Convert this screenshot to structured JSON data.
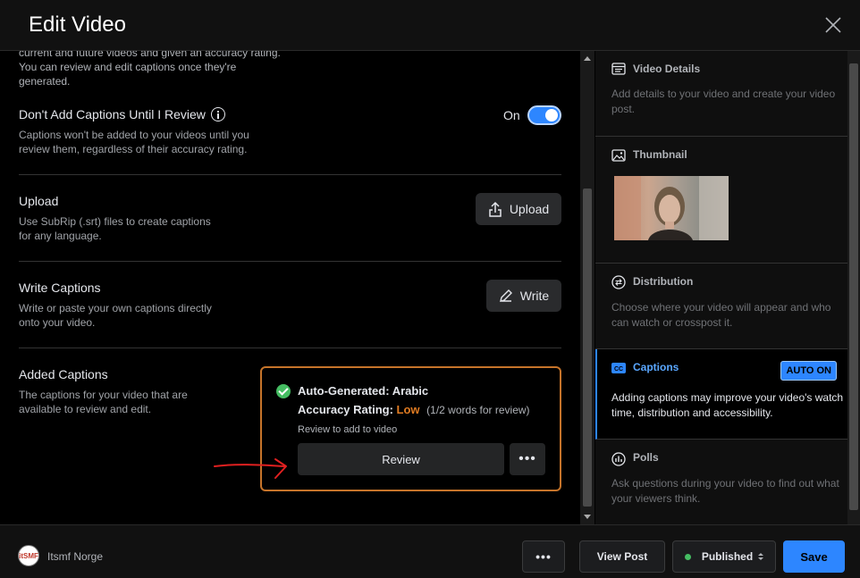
{
  "header": {
    "title": "Edit Video"
  },
  "left": {
    "faded_text": "current and future videos and given an accuracy rating. You can review and edit captions once they're generated.",
    "dont_add": {
      "title": "Don't Add Captions Until I Review",
      "desc": "Captions won't be added to your videos until you review them, regardless of their accuracy rating.",
      "toggle_label": "On",
      "toggle_on": true
    },
    "upload": {
      "title": "Upload",
      "desc": "Use SubRip (.srt) files to create captions for any language.",
      "button": "Upload"
    },
    "write": {
      "title": "Write Captions",
      "desc": "Write or paste your own captions directly onto your video.",
      "button": "Write"
    },
    "added": {
      "title": "Added Captions",
      "desc": "The captions for your video that are available to review and edit.",
      "card": {
        "name": "Auto-Generated: Arabic",
        "accuracy_label": "Accuracy Rating:",
        "accuracy_value": "Low",
        "words_note": "(1/2 words for review)",
        "hint": "Review to add to video",
        "review_button": "Review",
        "more_button": "•••"
      }
    }
  },
  "right": {
    "panels": [
      {
        "title": "Video Details",
        "desc": "Add details to your video and create your video post.",
        "icon": "video-details-icon"
      },
      {
        "title": "Thumbnail",
        "icon": "image-icon"
      },
      {
        "title": "Distribution",
        "desc": "Choose where your video will appear and who can watch or crosspost it.",
        "icon": "distribution-icon"
      },
      {
        "title": "Captions",
        "desc": "Adding captions may improve your video's watch time, distribution and accessibility.",
        "badge": "AUTO ON",
        "icon": "cc-icon"
      },
      {
        "title": "Polls",
        "desc": "Ask questions during your video to find out what your viewers think.",
        "icon": "poll-icon"
      }
    ]
  },
  "footer": {
    "avatar_text": "itSMF",
    "page_name": "Itsmf Norge",
    "more_button": "•••",
    "view_post": "View Post",
    "published": "Published",
    "save": "Save"
  },
  "colors": {
    "accent": "#2d86ff",
    "warning": "#e07b22",
    "success": "#45bd62"
  }
}
